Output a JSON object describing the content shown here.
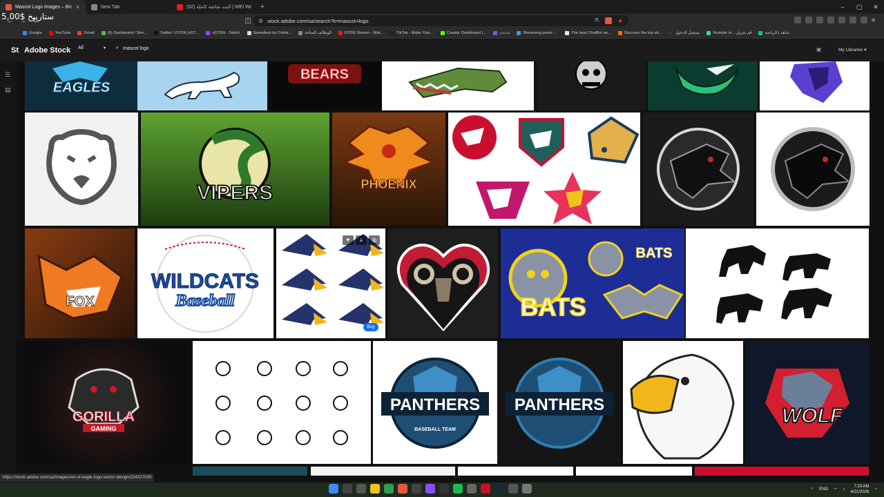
{
  "browser": {
    "tabs": [
      {
        "label": "Mascot Logo Images – Browse 1",
        "active": true,
        "color": "#e8573f"
      },
      {
        "label": "New Tab",
        "active": false,
        "color": "#888888"
      },
      {
        "label": "(62) البث شاشة كاملة | WEI Warriors",
        "active": false,
        "color": "#e02020"
      }
    ],
    "new_tab": "+",
    "window_controls": [
      "–",
      "▢",
      "✕"
    ],
    "overlay_text": "5,00$ ستاربيخ",
    "address": "stock.adobe.com/sa/search?k=mascot+logo",
    "bookmarks": [
      {
        "label": "Google",
        "color": "#4285f4"
      },
      {
        "label": "YouTube",
        "color": "#ff0000"
      },
      {
        "label": "Gmail",
        "color": "#ea4335"
      },
      {
        "label": "(5) Dashboard / Stre...",
        "color": "#5eb34f"
      },
      {
        "label": "Twitter \\ D7DN (vD7...",
        "color": "#111111"
      },
      {
        "label": "vD7DN - Twitch",
        "color": "#9146ff"
      },
      {
        "label": "Speedtest by Ookla...",
        "color": "#dddddd"
      },
      {
        "label": "الوظائف المتاحة",
        "color": "#888888"
      },
      {
        "label": "D7DN Stream - Wat...",
        "color": "#e02020"
      },
      {
        "label": "TikTok - Make Your...",
        "color": "#222222"
      },
      {
        "label": "Creator Dashboard |...",
        "color": "#53fc18"
      },
      {
        "label": "دددددد",
        "color": "#5865f2"
      },
      {
        "label": "Streaming panel -...",
        "color": "#4a90e2"
      },
      {
        "label": "The best ChatBot an...",
        "color": "#eeeeee"
      },
      {
        "label": "Discover the top str...",
        "color": "#ff6a00"
      },
      {
        "label": "تسجيل الدخول",
        "color": "#333333"
      },
      {
        "label": "Youtube m... قم بتنزيل",
        "color": "#3ddc84"
      },
      {
        "label": "شاهد | الرياضة",
        "color": "#19c37d"
      }
    ]
  },
  "stock": {
    "logo": "St",
    "name": "Adobe Stock",
    "filter": "All",
    "query": "mascot logo",
    "libraries": "My Libraries"
  },
  "images": [
    {
      "label": "EAGLES",
      "bg": "#0f2c3e",
      "fg": "#3bb3e6"
    },
    {
      "label": "panther",
      "bg": "#a9d4ef",
      "fg": "#ffffff"
    },
    {
      "label": "BEARS",
      "bg": "#0a0a0a",
      "fg": "#d32f2f"
    },
    {
      "label": "alligator",
      "bg": "#ffffff",
      "fg": "#5e8c3a"
    },
    {
      "label": "skull",
      "bg": "#1a1a1a",
      "fg": "#cfcfcf"
    },
    {
      "label": "serpent",
      "bg": "#0c3b2f",
      "fg": "#29c27a"
    },
    {
      "label": "wolf",
      "bg": "#ffffff",
      "fg": "#5b3fd1"
    },
    {
      "label": "bear",
      "bg": "#f1f1f1",
      "fg": "#555555"
    },
    {
      "label": "VIPERS",
      "bg": "#3f7a22",
      "fg": "#e9e4a7"
    },
    {
      "label": "PHOENIX",
      "bg": "#7a3a10",
      "fg": "#f08a1c"
    },
    {
      "label": "eagle set",
      "bg": "#ffffff",
      "fg": "#c8102e"
    },
    {
      "label": "dragon",
      "bg": "#1b1b1b",
      "fg": "#c62828"
    },
    {
      "label": "dragon",
      "bg": "#ffffff",
      "fg": "#1b1b1b"
    },
    {
      "label": "FOX",
      "bg": "#5a2a10",
      "fg": "#f07a22"
    },
    {
      "label": "WILDCATS",
      "bg": "#ffffff",
      "fg": "#1c4da1"
    },
    {
      "label": "Baseball",
      "bg": "#ffffff",
      "fg": "#1c4da1"
    },
    {
      "label": "eagle heads",
      "bg": "#ffffff",
      "fg": "#24336b"
    },
    {
      "label": "ram",
      "bg": "#1e1e1e",
      "fg": "#c21b34"
    },
    {
      "label": "BATS",
      "bg": "#1c2d96",
      "fg": "#f2d21b"
    },
    {
      "label": "bulls",
      "bg": "#ffffff",
      "fg": "#111111"
    },
    {
      "label": "GORILLA",
      "bg": "#0d0d0d",
      "fg": "#c41a2a"
    },
    {
      "label": "GAMING",
      "bg": "#0d0d0d",
      "fg": "#ffffff"
    },
    {
      "label": "faces",
      "bg": "#ffffff",
      "fg": "#111111"
    },
    {
      "label": "PANTHERS",
      "bg": "#ffffff",
      "fg": "#1f4e74"
    },
    {
      "label": "BASEBALL TEAM",
      "bg": "#ffffff",
      "fg": "#1f4e74"
    },
    {
      "label": "PANTHERS",
      "bg": "#151515",
      "fg": "#2f7fb0"
    },
    {
      "label": "eagle",
      "bg": "#ffffff",
      "fg": "#f2b61b"
    },
    {
      "label": "WOLF",
      "bg": "#0f1828",
      "fg": "#d31f2f"
    }
  ],
  "hover": {
    "buy": "Buy"
  },
  "status_url": "https://stock.adobe.com/sa/images/set-of-eagle-logo-vector-design/224327039",
  "taskbar": {
    "lang": "ENG",
    "time": "7:23 AM",
    "date": "4/21/2026"
  }
}
